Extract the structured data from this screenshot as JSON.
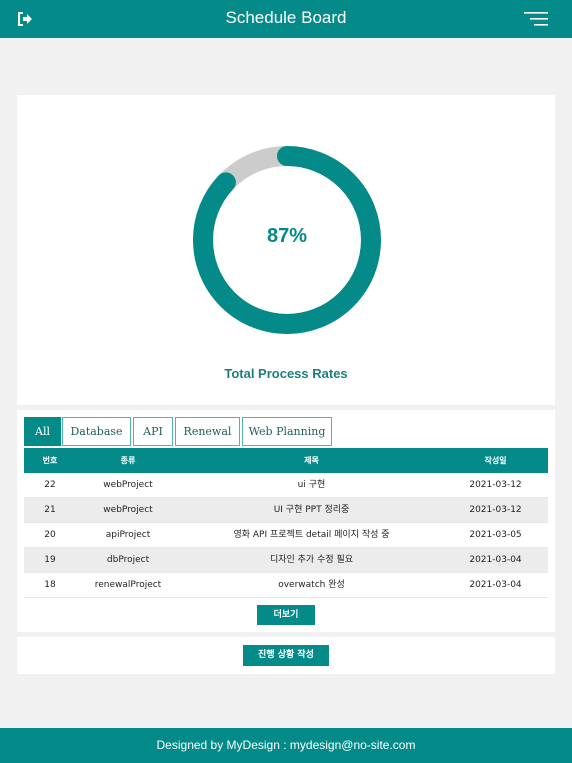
{
  "header": {
    "title": "Schedule Board",
    "logout_icon": "logout-icon",
    "menu_icon": "hamburger-menu-icon"
  },
  "progress": {
    "percent_label": "87%",
    "value": 0.87,
    "label": "Total Process Rates",
    "colors": {
      "fill": "#048b89",
      "track": "#cccccc"
    }
  },
  "tabs": [
    {
      "label": "All",
      "active": true
    },
    {
      "label": "Database",
      "active": false
    },
    {
      "label": "API",
      "active": false
    },
    {
      "label": "Renewal",
      "active": false
    },
    {
      "label": "Web Planning",
      "active": false
    }
  ],
  "table": {
    "headers": [
      "번호",
      "종류",
      "제목",
      "작성일"
    ],
    "rows": [
      [
        "22",
        "webProject",
        "ui 구현",
        "2021-03-12"
      ],
      [
        "21",
        "webProject",
        "UI 구현 PPT 정리중",
        "2021-03-12"
      ],
      [
        "20",
        "apiProject",
        "영화 API 프로젝트 detail 페이지 작성 중",
        "2021-03-05"
      ],
      [
        "19",
        "dbProject",
        "디자인 추가 수정 필요",
        "2021-03-04"
      ],
      [
        "18",
        "renewalProject",
        "overwatch 완성",
        "2021-03-04"
      ]
    ]
  },
  "more_button": "더보기",
  "write_button": "진행 상황 작성",
  "footer": "Designed by MyDesign : mydesign@no-site.com",
  "colors": {
    "brand": "#048b89",
    "background": "#f1f1f1"
  }
}
